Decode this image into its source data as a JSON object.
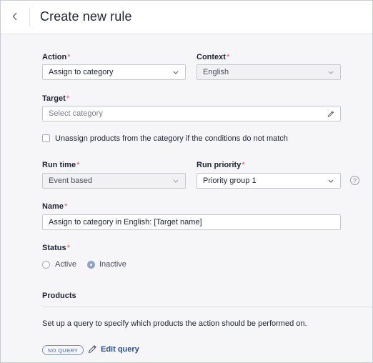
{
  "header": {
    "title": "Create new rule"
  },
  "required_marker": "*",
  "action": {
    "label": "Action",
    "value": "Assign to category"
  },
  "context": {
    "label": "Context",
    "value": "English"
  },
  "target": {
    "label": "Target",
    "placeholder": "Select category"
  },
  "unassign": {
    "label": "Unassign products from the category if the conditions do not match",
    "checked": false
  },
  "run_time": {
    "label": "Run time",
    "value": "Event based"
  },
  "run_priority": {
    "label": "Run priority",
    "value": "Priority group 1",
    "help": "?"
  },
  "name": {
    "label": "Name",
    "value": "Assign to category in English: [Target name]"
  },
  "status": {
    "label": "Status",
    "options": [
      "Active",
      "Inactive"
    ],
    "selected": "Inactive"
  },
  "products": {
    "title": "Products",
    "description": "Set up a query to specify which products the action should be performed on.",
    "badge": "NO QUERY",
    "edit_query": "Edit query"
  }
}
